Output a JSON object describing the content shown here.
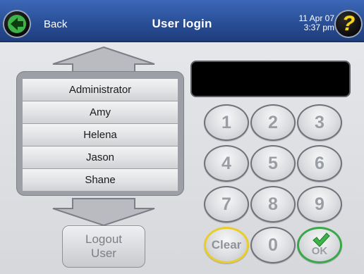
{
  "header": {
    "back_label": "Back",
    "title": "User login",
    "date": "11 Apr 07",
    "time": "3:37 pm",
    "help_symbol": "?",
    "icons": {
      "back": "green-left-arrow-icon",
      "help": "help-question-icon"
    }
  },
  "user_list": {
    "users": [
      "Administrator",
      "Amy",
      "Helena",
      "Jason",
      "Shane"
    ],
    "scroll_up_icon": "arrow-up-icon",
    "scroll_down_icon": "arrow-down-icon"
  },
  "logout": {
    "line1": "Logout",
    "line2": "User"
  },
  "pin_display": {
    "value": ""
  },
  "keypad": {
    "keys": [
      "1",
      "2",
      "3",
      "4",
      "5",
      "6",
      "7",
      "8",
      "9"
    ],
    "clear_label": "Clear",
    "zero_label": "0",
    "ok_label": "OK",
    "ok_icon": "checkmark-icon"
  },
  "colors": {
    "header_blue": "#2a4f98",
    "back_arrow_green": "#3cb449",
    "help_yellow": "#f6d41c",
    "clear_ring": "#e9cd2a",
    "ok_ring": "#39a84a"
  }
}
